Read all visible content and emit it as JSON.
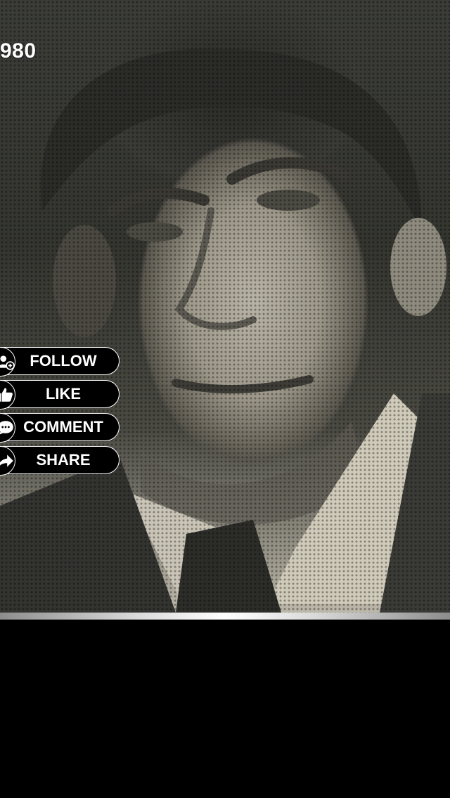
{
  "video": {
    "overlay_year": "980"
  },
  "actions": [
    {
      "label": "FOLLOW",
      "icon": "follow-icon"
    },
    {
      "label": "LIKE",
      "icon": "like-icon"
    },
    {
      "label": "COMMENT",
      "icon": "comment-icon"
    },
    {
      "label": "SHARE",
      "icon": "share-icon"
    }
  ],
  "colors": {
    "button_bg": "#000000",
    "button_text": "#ffffff",
    "bottom_area": "#000000"
  }
}
